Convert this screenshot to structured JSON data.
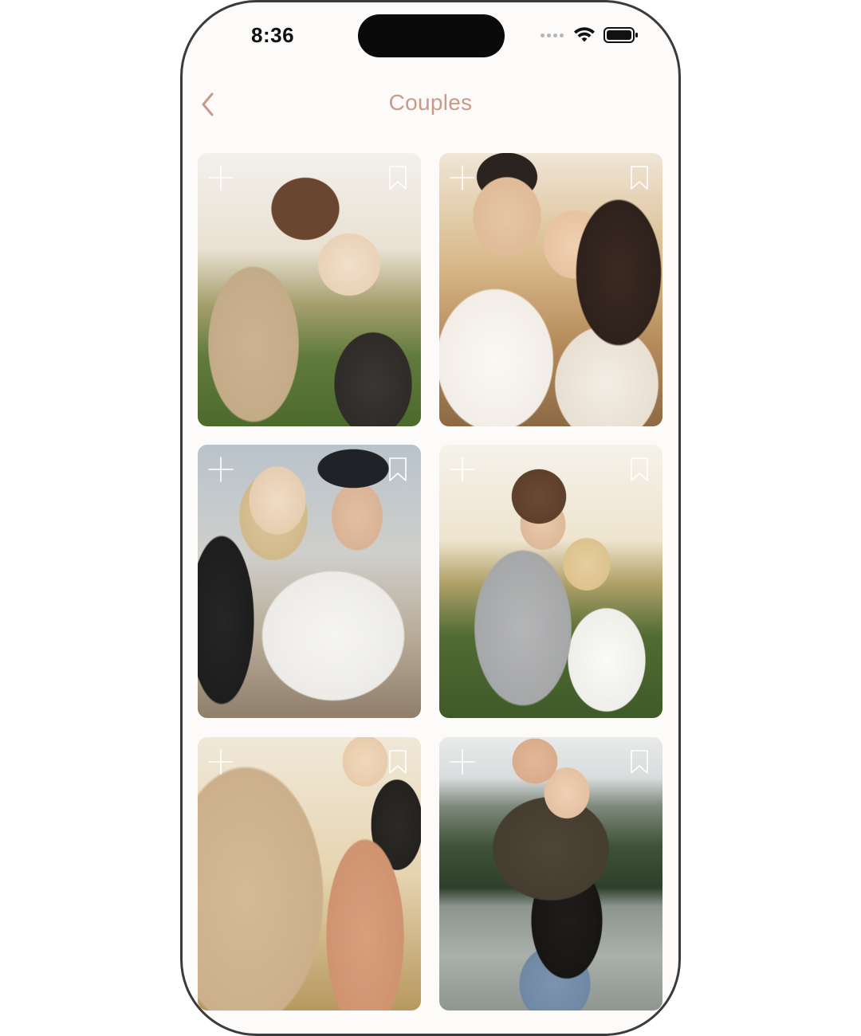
{
  "status_bar": {
    "time": "8:36"
  },
  "header": {
    "title": "Couples",
    "back_icon": "chevron-left-icon"
  },
  "colors": {
    "accent": "#c9998a",
    "background": "#fdfbf9"
  },
  "photos": [
    {
      "add_icon": "plus-icon",
      "save_icon": "bookmark-icon"
    },
    {
      "add_icon": "plus-icon",
      "save_icon": "bookmark-icon"
    },
    {
      "add_icon": "plus-icon",
      "save_icon": "bookmark-icon"
    },
    {
      "add_icon": "plus-icon",
      "save_icon": "bookmark-icon"
    },
    {
      "add_icon": "plus-icon",
      "save_icon": "bookmark-icon"
    },
    {
      "add_icon": "plus-icon",
      "save_icon": "bookmark-icon"
    }
  ]
}
